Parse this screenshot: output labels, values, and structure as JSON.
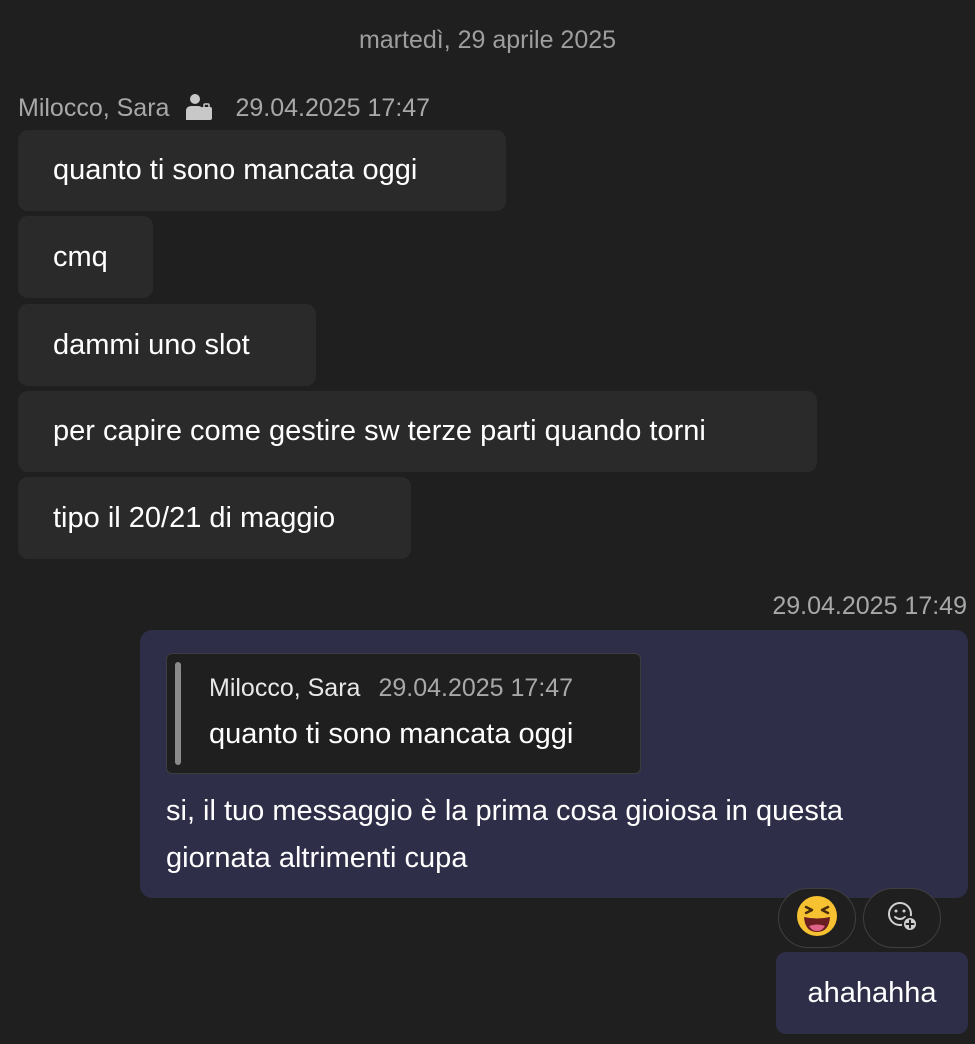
{
  "date_separator": "martedì, 29 aprile 2025",
  "incoming_group": {
    "sender": "Milocco, Sara",
    "timestamp": "29.04.2025 17:47",
    "status_icon": "busy-status-icon",
    "messages": [
      "quanto ti sono mancata oggi",
      "cmq",
      "dammi uno slot",
      "per capire come gestire sw terze parti quando torni",
      "tipo il 20/21 di maggio"
    ]
  },
  "outgoing_group": {
    "timestamp": "29.04.2025 17:49",
    "reply": {
      "quoted_sender": "Milocco, Sara",
      "quoted_timestamp": "29.04.2025 17:47",
      "quoted_text": "quanto ti sono mancata oggi",
      "text": "si, il tuo messaggio è la prima cosa gioiosa in questa giornata altrimenti cupa"
    },
    "reactions": [
      {
        "icon": "laughing-emoji-icon"
      },
      {
        "icon": "add-reaction-icon"
      }
    ],
    "next_message": "ahahahha"
  },
  "colors": {
    "background": "#1f1f1f",
    "incoming_bubble": "#2a2a2a",
    "outgoing_bubble": "#2e2e48",
    "meta_text": "#a8a8a8"
  }
}
